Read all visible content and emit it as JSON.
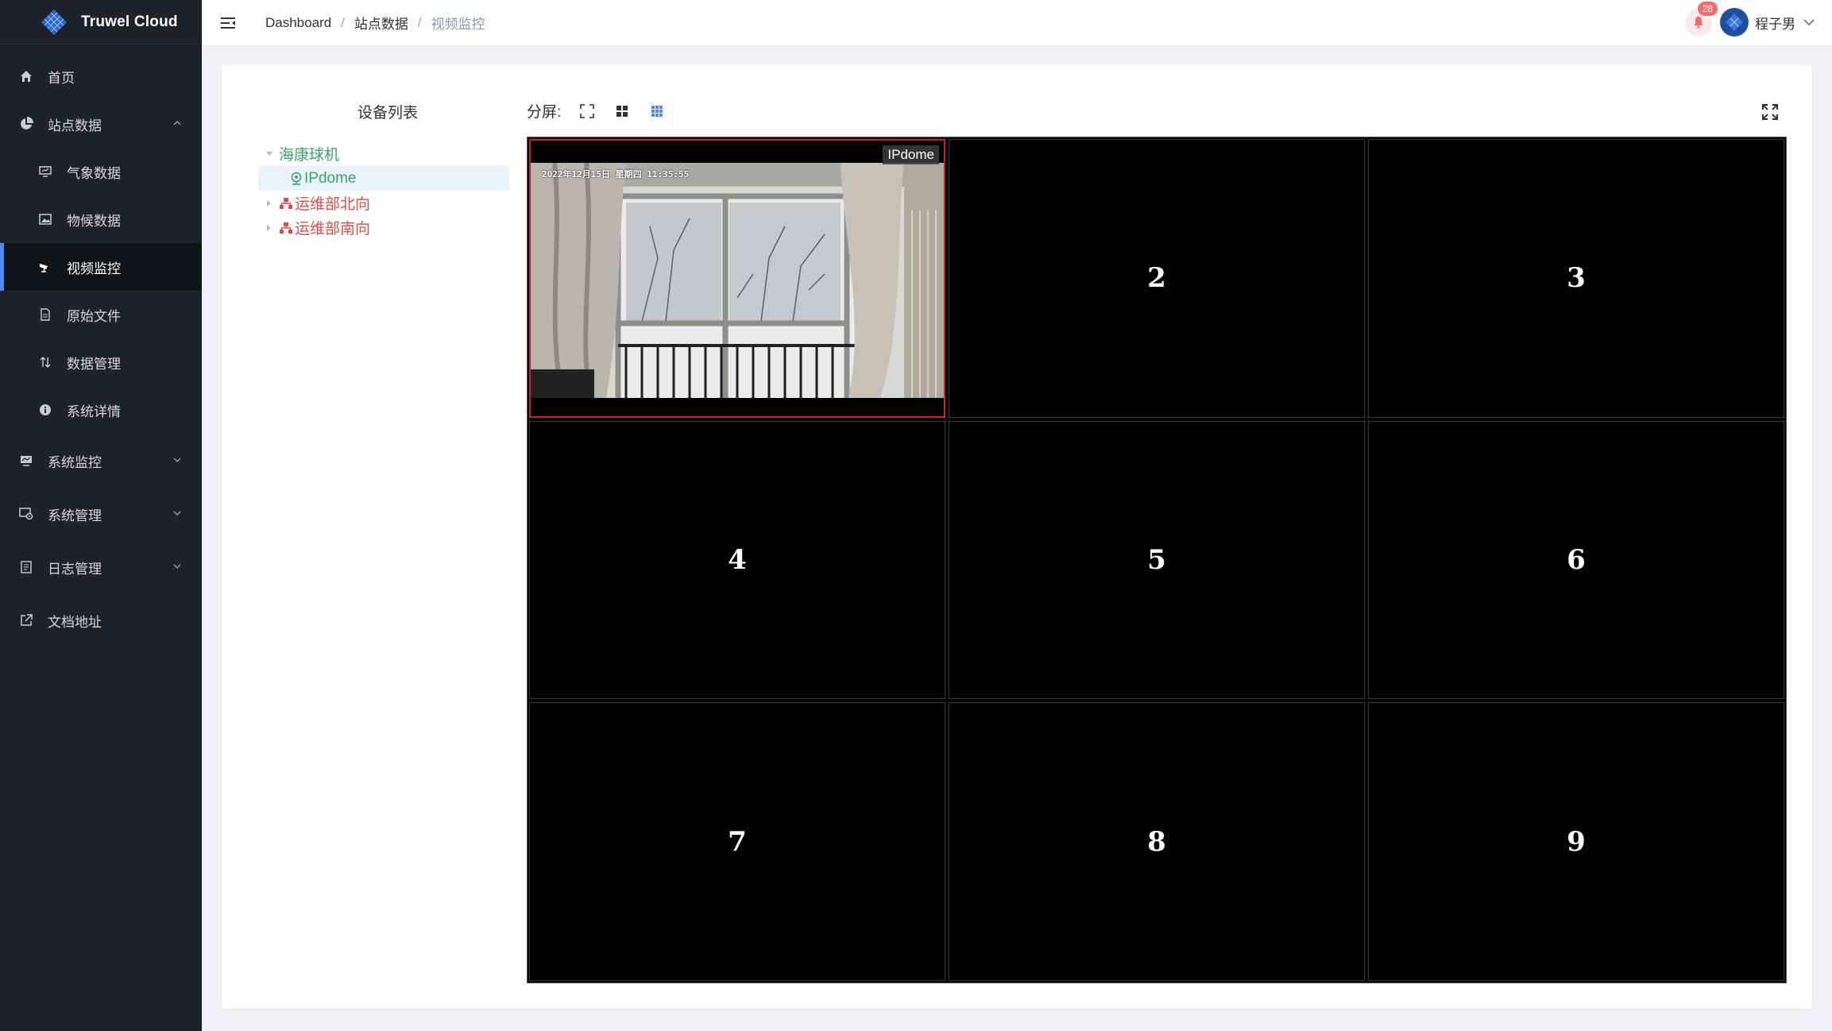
{
  "app": {
    "brand": "Truwel Cloud"
  },
  "sidebar": {
    "items": [
      {
        "label": "首页",
        "icon": "home-icon"
      },
      {
        "label": "站点数据",
        "icon": "pie-chart-icon",
        "expanded": true
      },
      {
        "label": "气象数据",
        "icon": "monitor-icon"
      },
      {
        "label": "物候数据",
        "icon": "image-icon"
      },
      {
        "label": "视频监控",
        "icon": "camera-icon",
        "active": true
      },
      {
        "label": "原始文件",
        "icon": "file-icon"
      },
      {
        "label": "数据管理",
        "icon": "sort-icon"
      },
      {
        "label": "系统详情",
        "icon": "info-icon"
      },
      {
        "label": "系统监控",
        "icon": "monitor-chart-icon"
      },
      {
        "label": "系统管理",
        "icon": "settings-icon"
      },
      {
        "label": "日志管理",
        "icon": "log-icon"
      },
      {
        "label": "文档地址",
        "icon": "external-link-icon"
      }
    ]
  },
  "header": {
    "breadcrumb": [
      "Dashboard",
      "站点数据",
      "视频监控"
    ],
    "separator": "/",
    "notification_count": "28",
    "username": "程子男"
  },
  "device_panel": {
    "title": "设备列表",
    "tree": [
      {
        "label": "海康球机",
        "color": "#3aa36b"
      },
      {
        "label": "IPdome",
        "color": "#3aa36b"
      },
      {
        "label": "运维部北向",
        "color": "#e04a4a"
      },
      {
        "label": "运维部南向",
        "color": "#e04a4a"
      }
    ]
  },
  "toolbar": {
    "split_label": "分屏:"
  },
  "grid": {
    "selected_label": "IPdome",
    "timestamp": "2022年12月15日  星期四  11:35:55",
    "cells": [
      "2",
      "3",
      "4",
      "5",
      "6",
      "7",
      "8",
      "9"
    ]
  }
}
